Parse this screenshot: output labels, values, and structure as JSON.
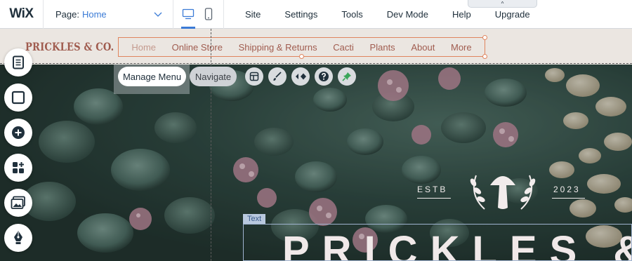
{
  "editor": {
    "logo": "WiX",
    "page_label": "Page:",
    "page_name": "Home",
    "menu": [
      "Site",
      "Settings",
      "Tools",
      "Dev Mode",
      "Help",
      "Upgrade"
    ],
    "collapse_glyph": "^",
    "accent_color": "#3b7bd6"
  },
  "site": {
    "brand": "PRICKLES & CO.",
    "nav": [
      "Home",
      "Online Store",
      "Shipping & Returns",
      "Cacti",
      "Plants",
      "About",
      "More"
    ],
    "nav_selected": "Home",
    "brand_color": "#a05c4f"
  },
  "toolbar": {
    "manage_menu": "Manage Menu",
    "navigate": "Navigate",
    "icons": [
      "layout-icon",
      "design-brush-icon",
      "animation-icon",
      "help-icon",
      "pin-icon"
    ]
  },
  "left_rail": {
    "icons": [
      "pages-icon",
      "background-icon",
      "add-icon",
      "app-market-icon",
      "media-icon",
      "pen-icon"
    ]
  },
  "hero": {
    "estb": "ESTB",
    "year": "2023",
    "text_tag": "Text",
    "title": "PRICKLES &"
  }
}
